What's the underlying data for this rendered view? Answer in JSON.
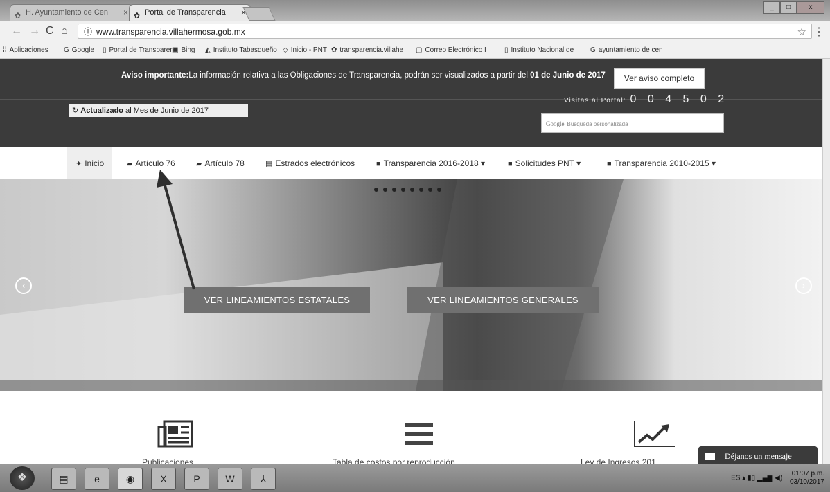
{
  "browser": {
    "tabs": [
      {
        "label": "H. Ayuntamiento de Cen",
        "active": false
      },
      {
        "label": "Portal de Transparencia",
        "active": true
      }
    ],
    "url": "www.transparencia.villahermosa.gob.mx",
    "bookmarks": [
      {
        "icon": "apps-icon",
        "label": "Aplicaciones"
      },
      {
        "icon": "google-icon",
        "label": "Google"
      },
      {
        "icon": "page-icon",
        "label": "Portal de Transparen"
      },
      {
        "icon": "bing-icon",
        "label": "Bing"
      },
      {
        "icon": "institute-icon",
        "label": "Instituto Tabasqueño"
      },
      {
        "icon": "pnt-icon",
        "label": "Inicio - PNT"
      },
      {
        "icon": "site-icon",
        "label": "transparencia.villahe"
      },
      {
        "icon": "mail-icon",
        "label": "Correo Electrónico I"
      },
      {
        "icon": "page-icon",
        "label": "Instituto Nacional de"
      },
      {
        "icon": "google-icon",
        "label": "ayuntamiento de cen"
      }
    ]
  },
  "header": {
    "notice_bold": "Aviso importante:",
    "notice_text": "La información relativa a las Obligaciones de Transparencia, podrán ser visualizados a partir del",
    "notice_date": "01 de Junio de 2017",
    "notice_button": "Ver aviso completo",
    "updated_bold": "Actualizado",
    "updated_text": " al Mes de Junio de 2017",
    "visits_label": "Visitas al Portal:",
    "visits_count": "0 0 4 5 0 2",
    "search_brand": "Google",
    "search_placeholder": "Búsqueda personalizada"
  },
  "nav": [
    {
      "label": "Inicio",
      "active": true
    },
    {
      "label": "Artículo 76",
      "active": false
    },
    {
      "label": "Artículo 78",
      "active": false
    },
    {
      "label": "Estrados electrónicos",
      "active": false
    },
    {
      "label": "Transparencia 2016-2018",
      "dropdown": true
    },
    {
      "label": "Solicitudes PNT",
      "dropdown": true
    },
    {
      "label": "Transparencia 2010-2015",
      "dropdown": true
    }
  ],
  "hero": {
    "slide_count": 8,
    "button_left": "VER LINEAMIENTOS ESTATALES",
    "button_right": "VER LINEAMIENTOS GENERALES"
  },
  "features": [
    {
      "icon": "newspaper-icon",
      "label": "Publicaciones"
    },
    {
      "icon": "list-icon",
      "label": "Tabla de costos por reproducción"
    },
    {
      "icon": "chart-trend-icon",
      "label": "Ley de Ingresos 201"
    }
  ],
  "chat": {
    "label": "Déjanos un mensaje"
  },
  "taskbar": {
    "apps": [
      "explorer",
      "internet-explorer",
      "chrome",
      "excel",
      "powerpoint",
      "word",
      "acrobat"
    ],
    "lang": "ES",
    "time": "01:07 p.m.",
    "date": "03/10/2017"
  },
  "colors": {
    "header_bg": "#3b3b3b",
    "cta_bg": "#707070",
    "arrow": "#2f2f2f"
  }
}
